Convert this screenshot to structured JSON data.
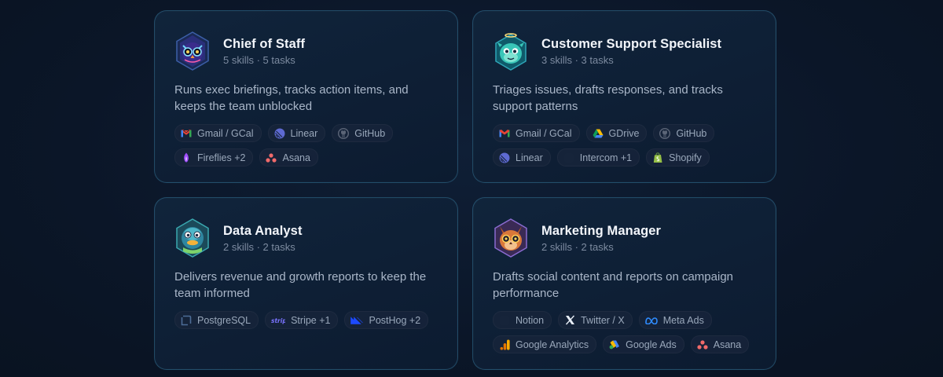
{
  "cards": [
    {
      "title": "Chief of Staff",
      "meta": "5 skills · 5 tasks",
      "description": "Runs exec briefings, tracks action items, and keeps the team unblocked",
      "tags": [
        {
          "label": "Gmail / GCal",
          "icon": "gmail-icon"
        },
        {
          "label": "Linear",
          "icon": "linear-icon"
        },
        {
          "label": "GitHub",
          "icon": "github-icon"
        },
        {
          "label": "Fireflies +2",
          "icon": "fireflies-icon"
        },
        {
          "label": "Asana",
          "icon": "asana-icon"
        }
      ]
    },
    {
      "title": "Customer Support Specialist",
      "meta": "3 skills · 3 tasks",
      "description": "Triages issues, drafts responses, and tracks support patterns",
      "tags": [
        {
          "label": "Gmail / GCal",
          "icon": "gmail-icon"
        },
        {
          "label": "GDrive",
          "icon": "gdrive-icon"
        },
        {
          "label": "GitHub",
          "icon": "github-icon"
        },
        {
          "label": "Linear",
          "icon": "linear-icon"
        },
        {
          "label": "Intercom +1",
          "icon": "intercom-icon"
        },
        {
          "label": "Shopify",
          "icon": "shopify-icon"
        }
      ]
    },
    {
      "title": "Data Analyst",
      "meta": "2 skills · 2 tasks",
      "description": "Delivers revenue and growth reports to keep the team informed",
      "tags": [
        {
          "label": "PostgreSQL",
          "icon": "postgresql-icon"
        },
        {
          "label": "Stripe +1",
          "icon": "stripe-icon"
        },
        {
          "label": "PostHog +2",
          "icon": "posthog-icon"
        }
      ]
    },
    {
      "title": "Marketing Manager",
      "meta": "2 skills · 2 tasks",
      "description": "Drafts social content and reports on campaign performance",
      "tags": [
        {
          "label": "Notion",
          "icon": "notion-icon"
        },
        {
          "label": "Twitter / X",
          "icon": "x-icon"
        },
        {
          "label": "Meta Ads",
          "icon": "meta-icon"
        },
        {
          "label": "Google Analytics",
          "icon": "google-analytics-icon"
        },
        {
          "label": "Google Ads",
          "icon": "google-ads-icon"
        },
        {
          "label": "Asana",
          "icon": "asana-icon"
        }
      ]
    }
  ],
  "colors": {
    "background": "#0b1628",
    "card": "#0e1f35",
    "card_border": "#2f6f8c",
    "title": "#f3f6fb",
    "meta": "#7d8ba0",
    "description": "#a9b6c8",
    "tag_bg": "#16243a",
    "tag_text": "#9aa8bb"
  },
  "avatars": [
    "owl-avatar-icon",
    "angel-creature-avatar-icon",
    "duck-avatar-icon",
    "fox-owl-avatar-icon"
  ]
}
